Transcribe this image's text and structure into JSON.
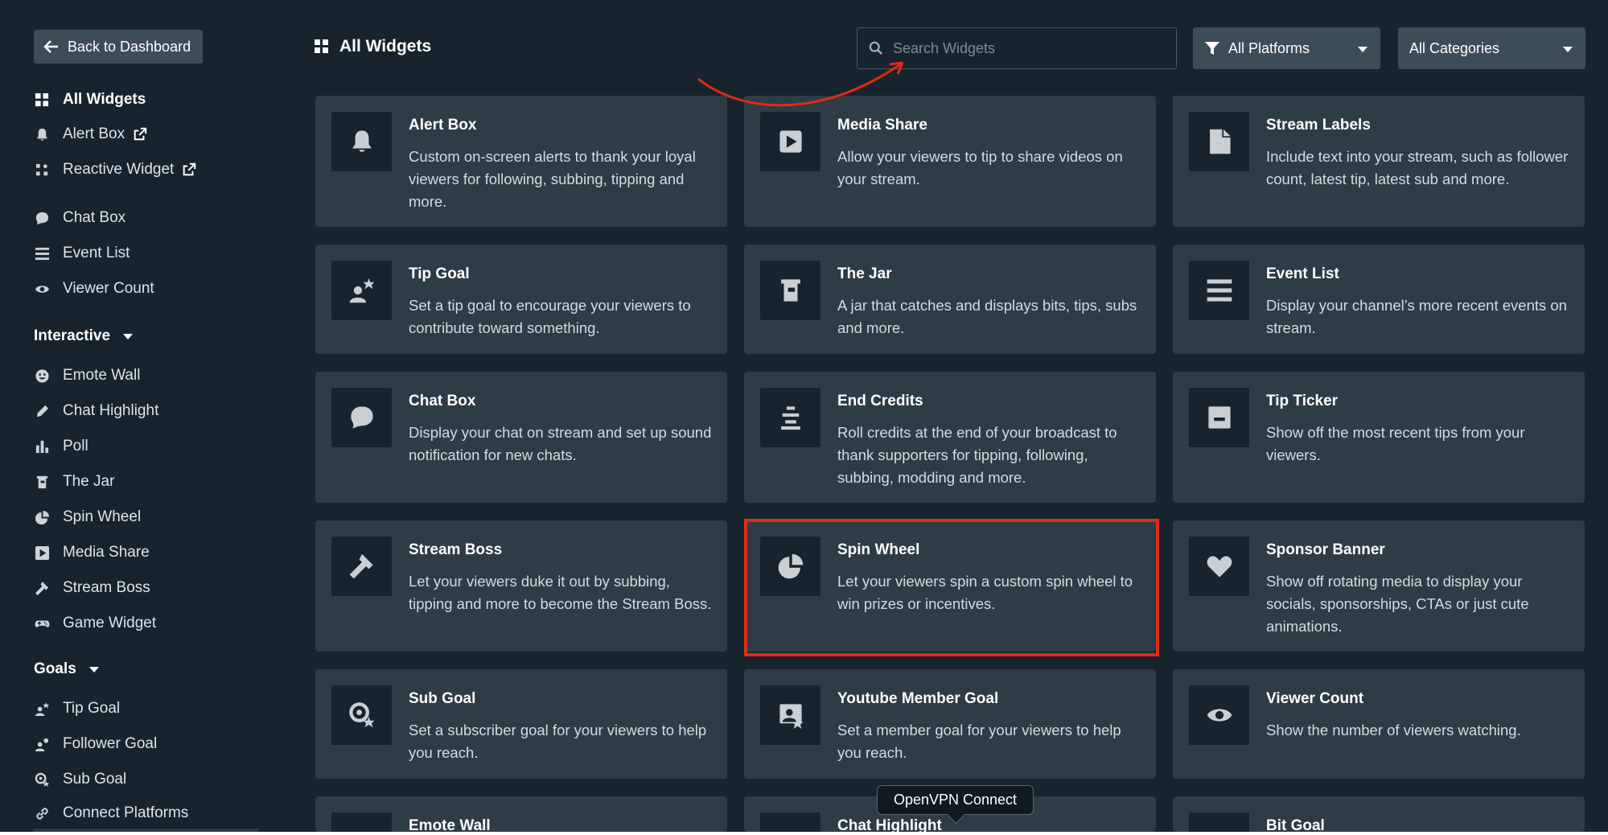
{
  "sidebar": {
    "back_label": "Back to Dashboard",
    "items_top": [
      {
        "label": "All Widgets",
        "icon": "grid-icon",
        "active": true
      },
      {
        "label": "Alert Box",
        "icon": "bell-icon",
        "external": true
      },
      {
        "label": "Reactive Widget",
        "icon": "reactive-icon",
        "external": true
      },
      {
        "label": "Chat Box",
        "icon": "chat-icon"
      },
      {
        "label": "Event List",
        "icon": "list-icon"
      },
      {
        "label": "Viewer Count",
        "icon": "eye-icon"
      }
    ],
    "interactive_heading": "Interactive",
    "interactive_items": [
      {
        "label": "Emote Wall",
        "icon": "emote-icon"
      },
      {
        "label": "Chat Highlight",
        "icon": "pen-icon"
      },
      {
        "label": "Poll",
        "icon": "poll-icon"
      },
      {
        "label": "The Jar",
        "icon": "jar-icon"
      },
      {
        "label": "Spin Wheel",
        "icon": "pie-icon"
      },
      {
        "label": "Media Share",
        "icon": "play-icon"
      },
      {
        "label": "Stream Boss",
        "icon": "hammer-icon"
      },
      {
        "label": "Game Widget",
        "icon": "gamepad-icon"
      }
    ],
    "goals_heading": "Goals",
    "goals_items": [
      {
        "label": "Tip Goal",
        "icon": "tip-goal-icon"
      },
      {
        "label": "Follower Goal",
        "icon": "follower-goal-icon"
      },
      {
        "label": "Sub Goal",
        "icon": "sub-goal-icon"
      },
      {
        "label": "Connect Platforms",
        "icon": "link-icon"
      }
    ]
  },
  "header": {
    "title": "All Widgets",
    "search_placeholder": "Search Widgets",
    "platform_filter": "All Platforms",
    "category_filter": "All Categories"
  },
  "cards": [
    {
      "title": "Alert Box",
      "desc": "Custom on-screen alerts to thank your loyal viewers for following, subbing, tipping and more.",
      "icon": "bell-icon"
    },
    {
      "title": "Media Share",
      "desc": "Allow your viewers to tip to share videos on your stream.",
      "icon": "play-icon"
    },
    {
      "title": "Stream Labels",
      "desc": "Include text into your stream, such as follower count, latest tip, latest sub and more.",
      "icon": "file-icon"
    },
    {
      "title": "Tip Goal",
      "desc": "Set a tip goal to encourage your viewers to contribute toward something.",
      "icon": "tip-goal-icon"
    },
    {
      "title": "The Jar",
      "desc": "A jar that catches and displays bits, tips, subs and more.",
      "icon": "jar-icon"
    },
    {
      "title": "Event List",
      "desc": "Display your channel’s more recent events on stream.",
      "icon": "list-icon"
    },
    {
      "title": "Chat Box",
      "desc": "Display your chat on stream and set up sound notification for new chats.",
      "icon": "chat-icon"
    },
    {
      "title": "End Credits",
      "desc": "Roll credits at the end of your broadcast to thank supporters for tipping, following, subbing, modding and more.",
      "icon": "credits-icon"
    },
    {
      "title": "Tip Ticker",
      "desc": "Show off the most recent tips from your viewers.",
      "icon": "ticker-icon"
    },
    {
      "title": "Stream Boss",
      "desc": "Let your viewers duke it out by subbing, tipping and more to become the Stream Boss.",
      "icon": "hammer-icon"
    },
    {
      "title": "Spin Wheel",
      "desc": "Let your viewers spin a custom spin wheel to win prizes or incentives.",
      "icon": "pie-icon"
    },
    {
      "title": "Sponsor Banner",
      "desc": "Show off rotating media to display your socials, sponsorships, CTAs or just cute animations.",
      "icon": "heart-icon"
    },
    {
      "title": "Sub Goal",
      "desc": "Set a subscriber goal for your viewers to help you reach.",
      "icon": "sub-goal-icon"
    },
    {
      "title": "Youtube Member Goal",
      "desc": "Set a member goal for your viewers to help you reach.",
      "icon": "member-goal-icon"
    },
    {
      "title": "Viewer Count",
      "desc": "Show the number of viewers watching.",
      "icon": "eye-icon"
    },
    {
      "title": "Emote Wall",
      "desc": "",
      "icon": "emote-icon"
    },
    {
      "title": "Chat Highlight",
      "desc": "",
      "icon": "pen-icon"
    },
    {
      "title": "Bit Goal",
      "desc": "",
      "icon": "bit-icon"
    }
  ],
  "tooltip": "OpenVPN Connect",
  "colors": {
    "background": "#17242d",
    "card": "#2e3c46",
    "highlight": "#e22a16",
    "button": "#3d4d57"
  }
}
